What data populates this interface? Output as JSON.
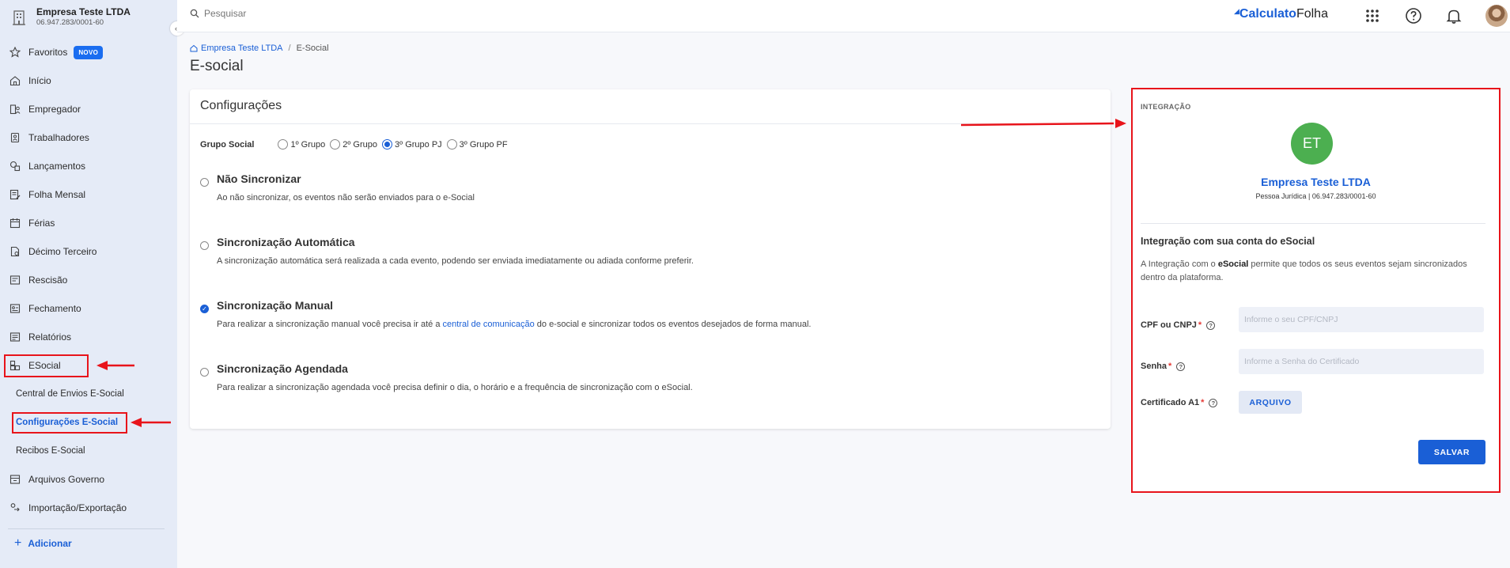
{
  "company": {
    "name": "Empresa Teste LTDA",
    "cnpj": "06.947.283/0001-60"
  },
  "sidebar": {
    "badge": "NOVO",
    "items": [
      {
        "label": "Favoritos",
        "icon": "star-icon"
      },
      {
        "label": "Início",
        "icon": "home-icon"
      },
      {
        "label": "Empregador",
        "icon": "employer-icon"
      },
      {
        "label": "Trabalhadores",
        "icon": "workers-icon"
      },
      {
        "label": "Lançamentos",
        "icon": "entries-icon"
      },
      {
        "label": "Folha Mensal",
        "icon": "payroll-icon"
      },
      {
        "label": "Férias",
        "icon": "calendar-icon"
      },
      {
        "label": "Décimo Terceiro",
        "icon": "document-icon"
      },
      {
        "label": "Rescisão",
        "icon": "termination-icon"
      },
      {
        "label": "Fechamento",
        "icon": "closing-icon"
      },
      {
        "label": "Relatórios",
        "icon": "reports-icon"
      },
      {
        "label": "ESocial",
        "icon": "esocial-icon"
      }
    ],
    "subitems": [
      {
        "label": "Central de Envios E-Social"
      },
      {
        "label": "Configurações E-Social"
      },
      {
        "label": "Recibos E-Social"
      }
    ],
    "items2": [
      {
        "label": "Arquivos Governo",
        "icon": "archive-icon"
      },
      {
        "label": "Importação/Exportação",
        "icon": "import-export-icon"
      }
    ],
    "add_label": "Adicionar"
  },
  "topbar": {
    "search_placeholder": "Pesquisar",
    "logo_main": "Calculato",
    "logo_folha": "Folha"
  },
  "breadcrumb": {
    "home": "Empresa Teste LTDA",
    "current": "E-Social"
  },
  "page_title": "E-social",
  "config": {
    "title": "Configurações",
    "grupo_label": "Grupo Social",
    "grupos": [
      {
        "label": "1º Grupo",
        "selected": false
      },
      {
        "label": "2º Grupo",
        "selected": false
      },
      {
        "label": "3º Grupo PJ",
        "selected": true
      },
      {
        "label": "3º Grupo PF",
        "selected": false
      }
    ],
    "options": [
      {
        "title": "Não Sincronizar",
        "desc": "Ao não sincronizar, os eventos não serão enviados para o e-Social",
        "selected": false
      },
      {
        "title": "Sincronização Automática",
        "desc": "A sincronização automática será realizada a cada evento, podendo ser enviada imediatamente ou adiada conforme preferir.",
        "selected": false
      },
      {
        "title": "Sincronização Manual",
        "desc_pre": "Para realizar a sincronização manual você precisa ir até a ",
        "desc_link": "central de comunicação",
        "desc_post": " do e-social e sincronizar todos os eventos desejados de forma manual.",
        "selected": true
      },
      {
        "title": "Sincronização Agendada",
        "desc": "Para realizar a sincronização agendada você precisa definir o dia, o horário e a frequência de sincronização com o eSocial.",
        "selected": false
      }
    ]
  },
  "integration": {
    "header": "INTEGRAÇÃO",
    "initials": "ET",
    "name": "Empresa Teste LTDA",
    "type": "Pessoa Jurídica | 06.947.283/0001-60",
    "title": "Integração com sua conta do eSocial",
    "desc_pre": "A Integração com o ",
    "desc_bold": "eSocial",
    "desc_post": " permite que todos os seus eventos sejam sincronizados dentro da plataforma.",
    "cpf_label": "CPF ou CNPJ",
    "cpf_placeholder": "Informe o seu CPF/CNPJ",
    "senha_label": "Senha",
    "senha_placeholder": "Informe a Senha do Certificado",
    "cert_label": "Certificado A1",
    "required_mark": "*",
    "arquivo_label": "ARQUIVO",
    "salvar_label": "SALVAR"
  },
  "colors": {
    "accent": "#1a5fd6",
    "annotation": "#e8141b",
    "avatar": "#4caf50",
    "sidebar_bg": "#e5ebf7"
  }
}
